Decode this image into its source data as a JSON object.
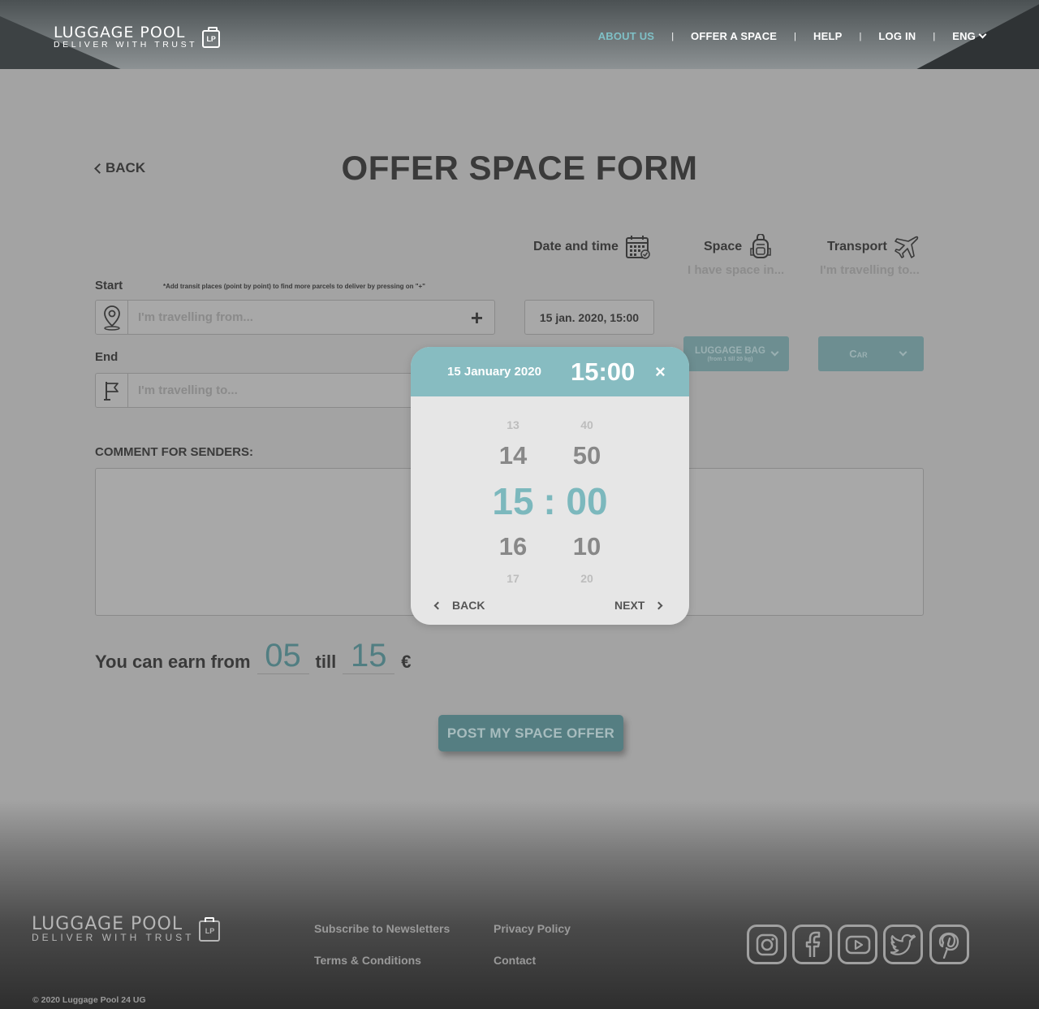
{
  "header": {
    "logo_name": "LUGGAGE POOL",
    "logo_tagline": "DELIVER WITH TRUST",
    "logo_badge": "LP",
    "nav": {
      "about_us": "ABOUT US",
      "offer_space": "OFFER A SPACE",
      "help": "HELP",
      "login": "LOG IN",
      "language": "ENG",
      "separator": "|"
    },
    "active_color": "#7fc0c6"
  },
  "page": {
    "back": "BACK",
    "title": "OFFER SPACE FORM"
  },
  "columns": {
    "date_time": "Date and time",
    "space": "Space",
    "space_placeholder": "I have space in...",
    "transport": "Transport",
    "transport_placeholder": "I'm travelling to..."
  },
  "form": {
    "start_label": "Start",
    "transit_hint": "*Add transit places (point by point) to find more parcels to deliver by pressing on \"+\"",
    "start_placeholder": "I'm travelling from...",
    "plus": "+",
    "end_label": "End",
    "end_placeholder": "I'm travelling to...",
    "date_value": "15 jan. 2020, 15:00",
    "space_select": "LUGGAGE BAG",
    "space_select_sub": "(from 1 till 20 kg)",
    "transport_select": "Car",
    "comment_label": "COMMENT FOR SENDERS:",
    "earn_prefix": "You can earn from",
    "earn_from": "05",
    "earn_mid": "till",
    "earn_to": "15",
    "earn_currency": "€",
    "submit": "POST MY SPACE OFFER"
  },
  "modal": {
    "date": "15 January 2020",
    "time": "15:00",
    "close": "×",
    "hours": [
      "13",
      "14",
      "15",
      "16",
      "17"
    ],
    "minutes": [
      "40",
      "50",
      "00",
      "10",
      "20"
    ],
    "colon": ":",
    "back": "BACK",
    "next": "NEXT",
    "accent": "#87bcc1"
  },
  "footer": {
    "logo_name": "LUGGAGE POOL",
    "logo_tagline": "DELIVER WITH TRUST",
    "logo_badge": "LP",
    "links": {
      "newsletter": "Subscribe to Newsletters",
      "terms": "Terms & Conditions",
      "privacy": "Privacy Policy",
      "contact": "Contact"
    },
    "social": [
      "instagram-icon",
      "facebook-icon",
      "youtube-icon",
      "twitter-icon",
      "pinterest-icon"
    ],
    "copyright": "© 2020  Luggage Pool 24 UG"
  }
}
